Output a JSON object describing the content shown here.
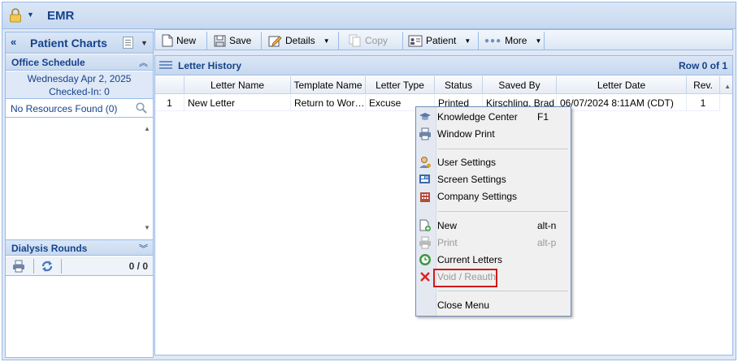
{
  "app": {
    "title": "EMR"
  },
  "left": {
    "patient_charts_title": "Patient Charts",
    "office_schedule": {
      "title": "Office Schedule",
      "date": "Wednesday Apr 2, 2025",
      "checked_in": "Checked-In: 0",
      "no_resources": "No Resources Found (0)"
    },
    "dialysis": {
      "title": "Dialysis Rounds",
      "count": "0 / 0"
    }
  },
  "toolbar": {
    "new": "New",
    "save": "Save",
    "details": "Details",
    "copy": "Copy",
    "patient": "Patient",
    "more": "More"
  },
  "grid": {
    "title": "Letter History",
    "row_status": "Row 0 of 1",
    "columns": [
      "Letter Name",
      "Template Name",
      "Letter Type",
      "Status",
      "Saved By",
      "Letter Date",
      "Rev."
    ],
    "rows": [
      {
        "num": "1",
        "letter_name": "New Letter",
        "template_name": "Return to Wor…",
        "letter_type": "Excuse",
        "status": "Printed",
        "saved_by": "Kirschling, Brad",
        "letter_date": "06/07/2024  8:11AM (CDT)",
        "rev": "1"
      }
    ]
  },
  "menu": {
    "knowledge_center": {
      "label": "Knowledge Center",
      "shortcut": "F1"
    },
    "window_print": {
      "label": "Window Print"
    },
    "user_settings": {
      "label": "User Settings"
    },
    "screen_settings": {
      "label": "Screen Settings"
    },
    "company_settings": {
      "label": "Company Settings"
    },
    "new": {
      "label": "New",
      "shortcut": "alt-n"
    },
    "print": {
      "label": "Print",
      "shortcut": "alt-p"
    },
    "current_letters": {
      "label": "Current Letters"
    },
    "void_reauth": {
      "label": "Void / Reauth"
    },
    "close_menu": {
      "label": "Close Menu"
    }
  },
  "colors": {
    "header_text": "#15428b",
    "border": "#99bbe8",
    "highlight_box": "#d01a1a"
  }
}
